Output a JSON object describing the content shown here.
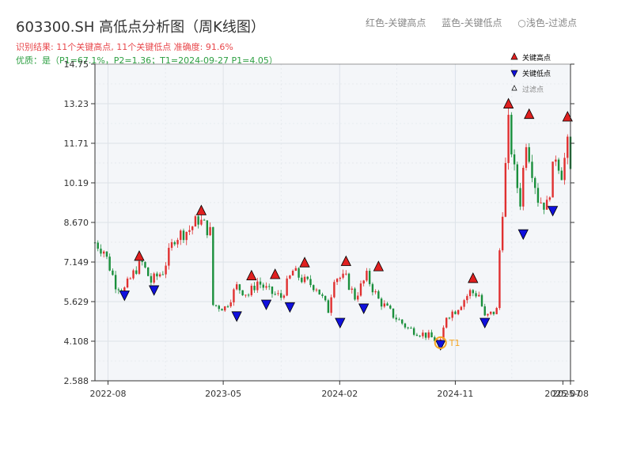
{
  "header": {
    "title": "603300.SH 高低点分析图（周K线图）",
    "top_legend": [
      "红色-关键高点",
      "蓝色-关键低点",
      "○浅色-过滤点"
    ],
    "result_text": "识别结果: 11个关键高点, 11个关键低点   准确度: 91.6%",
    "quality_text": "优质：是（P1=67.1%，P2=1.36；T1=2024-09-27 P1=4.05）"
  },
  "colors": {
    "up": "#e03030",
    "down": "#1a8f3c",
    "high_marker": "#e02020",
    "low_marker": "#1010dd",
    "t1_marker": "#f5a623",
    "plot_bg": "#f4f6f9",
    "grid": "#dde2e8"
  },
  "chart_data": {
    "type": "candlestick",
    "x_axis": {
      "start": "2022-07-01",
      "end": "2025-08-01",
      "ticks": [
        {
          "date": "2022-08-01",
          "label": "2022-08"
        },
        {
          "date": "2023-05-01",
          "label": "2023-05"
        },
        {
          "date": "2024-02-01",
          "label": "2024-02"
        },
        {
          "date": "2024-11-01",
          "label": "2024-11"
        },
        {
          "date": "2025-07-14",
          "label": "2025-07"
        },
        {
          "date": "2025-08-01",
          "label": "2025-08"
        }
      ]
    },
    "y_axis": {
      "min": 2.588,
      "max": 14.75,
      "ticks": [
        "2.588",
        "4.108",
        "5.629",
        "7.149",
        "8.670",
        "10.19",
        "11.71",
        "13.23",
        "14.75"
      ]
    },
    "legend": {
      "position": "top-right",
      "items": [
        {
          "kind": "high",
          "label": "关键高点"
        },
        {
          "kind": "low",
          "label": "关键低点"
        },
        {
          "kind": "filtered",
          "label": "过滤点"
        }
      ]
    },
    "close_path": [
      [
        "2022-07-01",
        7.9
      ],
      [
        "2022-07-22",
        7.6
      ],
      [
        "2022-08-19",
        6.3
      ],
      [
        "2022-09-09",
        6.1
      ],
      [
        "2022-10-07",
        6.9
      ],
      [
        "2022-10-21",
        7.1
      ],
      [
        "2022-11-11",
        6.4
      ],
      [
        "2022-12-09",
        6.8
      ],
      [
        "2023-01-06",
        8.1
      ],
      [
        "2023-02-10",
        8.4
      ],
      [
        "2023-03-03",
        8.8
      ],
      [
        "2023-03-31",
        8.3
      ],
      [
        "2023-04-07",
        5.5
      ],
      [
        "2023-05-05",
        5.4
      ],
      [
        "2023-06-02",
        6.2
      ],
      [
        "2023-06-30",
        5.9
      ],
      [
        "2023-07-21",
        6.4
      ],
      [
        "2023-08-18",
        6.0
      ],
      [
        "2023-09-15",
        5.8
      ],
      [
        "2023-10-13",
        6.8
      ],
      [
        "2023-11-10",
        6.4
      ],
      [
        "2023-12-08",
        6.2
      ],
      [
        "2024-01-05",
        5.3
      ],
      [
        "2024-01-19",
        6.6
      ],
      [
        "2024-02-16",
        6.5
      ],
      [
        "2024-03-08",
        5.8
      ],
      [
        "2024-04-05",
        6.6
      ],
      [
        "2024-05-03",
        5.7
      ],
      [
        "2024-06-07",
        5.1
      ],
      [
        "2024-07-12",
        4.6
      ],
      [
        "2024-08-30",
        4.3
      ],
      [
        "2024-09-27",
        4.05
      ],
      [
        "2024-10-11",
        5.1
      ],
      [
        "2024-11-01",
        5.3
      ],
      [
        "2024-12-06",
        6.0
      ],
      [
        "2024-12-27",
        5.9
      ],
      [
        "2025-01-10",
        5.0
      ],
      [
        "2025-02-07",
        5.3
      ],
      [
        "2025-02-14",
        7.6
      ],
      [
        "2025-03-07",
        12.4
      ],
      [
        "2025-03-21",
        10.6
      ],
      [
        "2025-04-04",
        9.5
      ],
      [
        "2025-04-18",
        11.9
      ],
      [
        "2025-05-16",
        9.6
      ],
      [
        "2025-06-06",
        9.3
      ],
      [
        "2025-06-27",
        11.3
      ],
      [
        "2025-07-11",
        10.6
      ],
      [
        "2025-07-25",
        11.6
      ],
      [
        "2025-08-01",
        10.6
      ]
    ],
    "highs": [
      {
        "date": "2022-10-14",
        "price": 7.15
      },
      {
        "date": "2023-03-10",
        "price": 8.9
      },
      {
        "date": "2023-07-07",
        "price": 6.4
      },
      {
        "date": "2023-09-01",
        "price": 6.45
      },
      {
        "date": "2023-11-10",
        "price": 6.9
      },
      {
        "date": "2024-02-16",
        "price": 6.95
      },
      {
        "date": "2024-05-03",
        "price": 6.75
      },
      {
        "date": "2024-12-13",
        "price": 6.3
      },
      {
        "date": "2025-03-07",
        "price": 13.0
      },
      {
        "date": "2025-04-25",
        "price": 12.6
      },
      {
        "date": "2025-07-25",
        "price": 12.5
      }
    ],
    "lows": [
      {
        "date": "2022-09-09",
        "price": 6.1
      },
      {
        "date": "2022-11-18",
        "price": 6.3
      },
      {
        "date": "2023-06-02",
        "price": 5.3
      },
      {
        "date": "2023-08-11",
        "price": 5.75
      },
      {
        "date": "2023-10-06",
        "price": 5.65
      },
      {
        "date": "2024-02-02",
        "price": 5.05
      },
      {
        "date": "2024-03-29",
        "price": 5.6
      },
      {
        "date": "2024-09-27",
        "price": 4.2
      },
      {
        "date": "2025-01-10",
        "price": 5.05
      },
      {
        "date": "2025-04-11",
        "price": 8.45
      },
      {
        "date": "2025-06-20",
        "price": 9.35
      }
    ],
    "t1": {
      "date": "2024-09-27",
      "price": 4.05,
      "label": "T1"
    }
  }
}
